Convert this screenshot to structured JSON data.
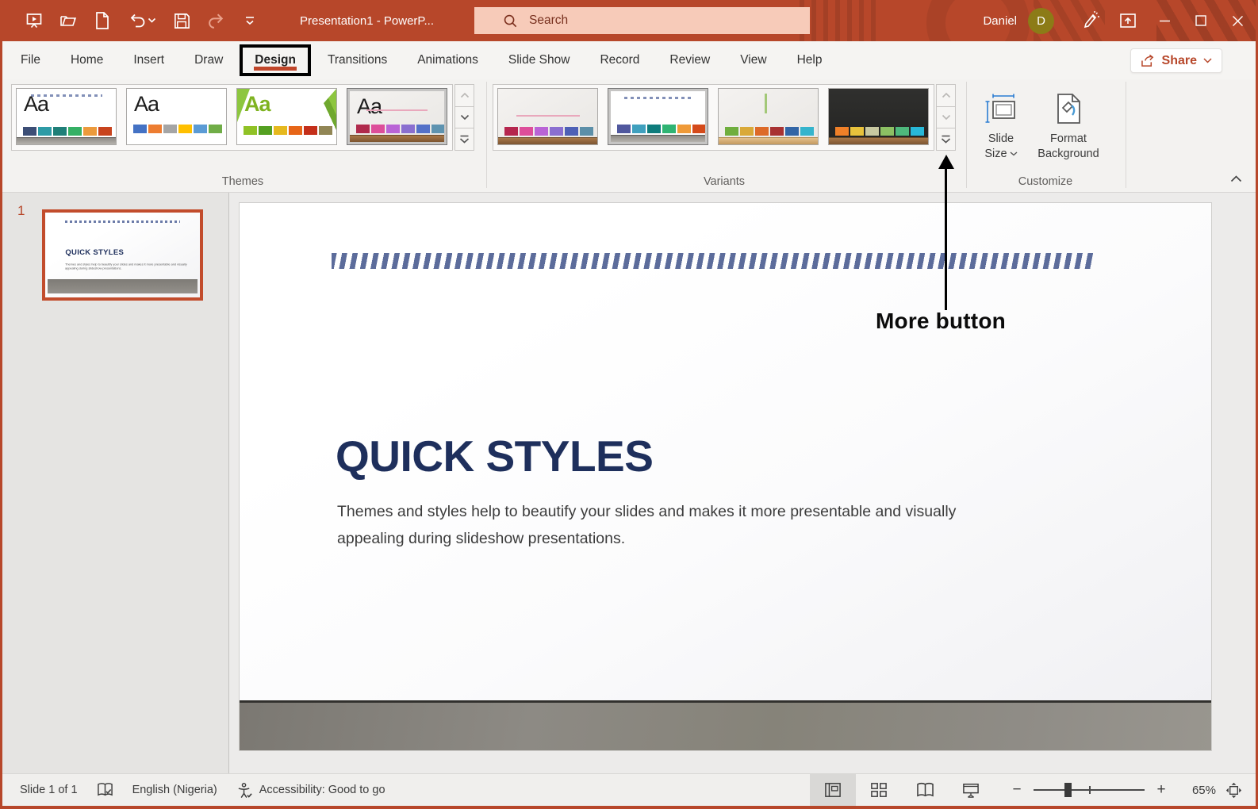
{
  "colors": {
    "accent": "#B7472A",
    "slide_title_navy": "#1E2F5C",
    "search_box": "#F7CBB9",
    "annotation_black": "#000000"
  },
  "title_bar": {
    "window_title": "Presentation1  -  PowerP...",
    "search_placeholder": "Search",
    "user_name": "Daniel",
    "user_initial": "D"
  },
  "tabs": {
    "items": [
      "File",
      "Home",
      "Insert",
      "Draw",
      "Design",
      "Transitions",
      "Animations",
      "Slide Show",
      "Record",
      "Review",
      "View",
      "Help"
    ],
    "active": "Design",
    "share_label": "Share"
  },
  "ribbon": {
    "themes": {
      "group_label": "Themes",
      "items": [
        {
          "label": "Aa",
          "swatches": [
            "#3C4E76",
            "#2E9BA6",
            "#1F7F78",
            "#35B065",
            "#EC9A3C",
            "#C8441E"
          ]
        },
        {
          "label": "Aa",
          "swatches": [
            "#4472C4",
            "#ED7D31",
            "#A5A5A5",
            "#FFC000",
            "#5B9BD5",
            "#70AD47"
          ]
        },
        {
          "label": "Aa",
          "swatches": [
            "#90C226",
            "#54A021",
            "#E6B91E",
            "#E76618",
            "#C42F1A",
            "#918655"
          ]
        },
        {
          "label": "Aa",
          "swatches": [
            "#B02A4C",
            "#DD4E9A",
            "#B964D6",
            "#8A6FD0",
            "#5471C8",
            "#5E93B0"
          ]
        }
      ]
    },
    "variants": {
      "group_label": "Variants",
      "items": [
        {
          "swatches": [
            "#B5264E",
            "#DD4E9A",
            "#B964D6",
            "#8A6FD0",
            "#4E60B6",
            "#5C8FA8"
          ]
        },
        {
          "swatches": [
            "#50589E",
            "#3FA0BE",
            "#0E7C7C",
            "#2FB473",
            "#EF9A38",
            "#D44A1A"
          ]
        },
        {
          "swatches": [
            "#6FAE3E",
            "#D9A938",
            "#DD6A28",
            "#A83232",
            "#3265A6",
            "#35B4CC"
          ]
        },
        {
          "swatches": [
            "#F08028",
            "#E8C23C",
            "#C8C8A0",
            "#8CC063",
            "#4EB87C",
            "#28B8D8"
          ]
        }
      ]
    },
    "customize": {
      "group_label": "Customize",
      "slide_size_line1": "Slide",
      "slide_size_line2": "Size",
      "format_bg_line1": "Format",
      "format_bg_line2": "Background"
    }
  },
  "annotation": {
    "label": "More button"
  },
  "slides_panel": {
    "slide_number": "1"
  },
  "slide": {
    "title": "QUICK STYLES",
    "body": "Themes and styles help to beautify your slides and makes it more presentable and visually appealing during slideshow presentations."
  },
  "status_bar": {
    "slide_indicator": "Slide 1 of 1",
    "language": "English (Nigeria)",
    "accessibility": "Accessibility: Good to go",
    "zoom_level": "65%"
  }
}
